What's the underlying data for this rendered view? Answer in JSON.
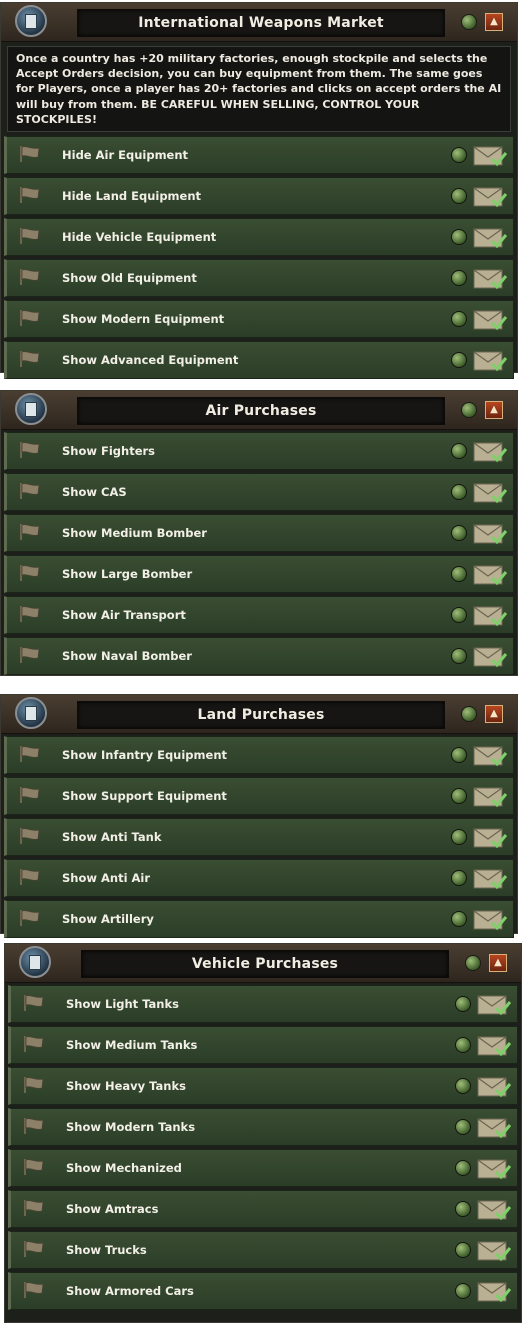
{
  "panels": [
    {
      "title": "International Weapons Market",
      "description": "Once a country has +20 military factories, enough stockpile and selects the Accept Orders decision, you can buy equipment from them. The same goes for Players, once a player has 20+ factories and clicks on accept orders the AI will buy from them. BE CAREFUL WHEN SELLING, CONTROL YOUR STOCKPILES!",
      "items": [
        "Hide Air Equipment",
        "Hide Land Equipment",
        "Hide Vehicle Equipment",
        "Show Old Equipment",
        "Show Modern Equipment",
        "Show Advanced Equipment"
      ]
    },
    {
      "title": "Air Purchases",
      "items": [
        "Show Fighters",
        "Show CAS",
        "Show Medium Bomber",
        "Show Large Bomber",
        "Show Air Transport",
        "Show Naval Bomber"
      ]
    },
    {
      "title": "Land Purchases",
      "items": [
        "Show Infantry Equipment",
        "Show Support Equipment",
        "Show Anti Tank",
        "Show Anti Air",
        "Show Artillery"
      ]
    },
    {
      "title": "Vehicle Purchases",
      "items": [
        "Show Light Tanks",
        "Show Medium Tanks",
        "Show Heavy Tanks",
        "Show Modern Tanks",
        "Show Mechanized",
        "Show Amtracs",
        "Show Trucks",
        "Show Armored Cars"
      ]
    }
  ],
  "colors": {
    "row_green": "#2f4229",
    "header_brown": "#3d3228",
    "collapse_red": "#9a3a18"
  },
  "icons": {
    "emblem": "document-emblem-icon",
    "row_flag": "flag-icon",
    "row_status": "status-dot-icon",
    "row_action": "envelope-check-icon",
    "collapse": "collapse-arrow-icon"
  }
}
